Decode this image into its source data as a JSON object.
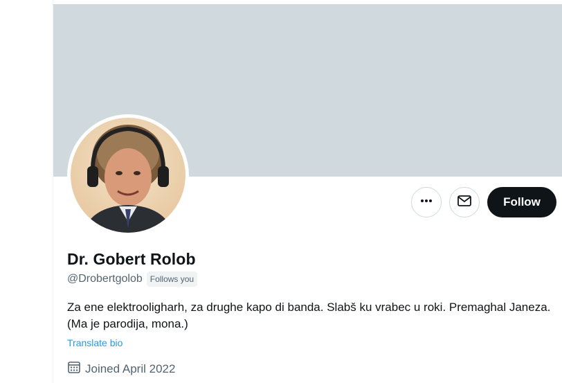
{
  "profile": {
    "display_name": "Dr. Gobert Rolob",
    "handle": "@Drobertgolob",
    "follows_you_badge": "Follows you",
    "bio": "Za ene elektrooligharh, za drughe kapo di banda. Slabš ku vrabec u roki. Premaghal Janeza. (Ma je parodija, mona.)",
    "translate_bio": "Translate bio",
    "joined": "Joined April 2022"
  },
  "actions": {
    "more_icon": "more-dots-icon",
    "message_icon": "envelope-icon",
    "follow_label": "Follow"
  },
  "colors": {
    "banner": "#cfd9de",
    "follow_button": "#0f1419",
    "link": "#1d9bf0",
    "secondary_text": "#536471"
  }
}
